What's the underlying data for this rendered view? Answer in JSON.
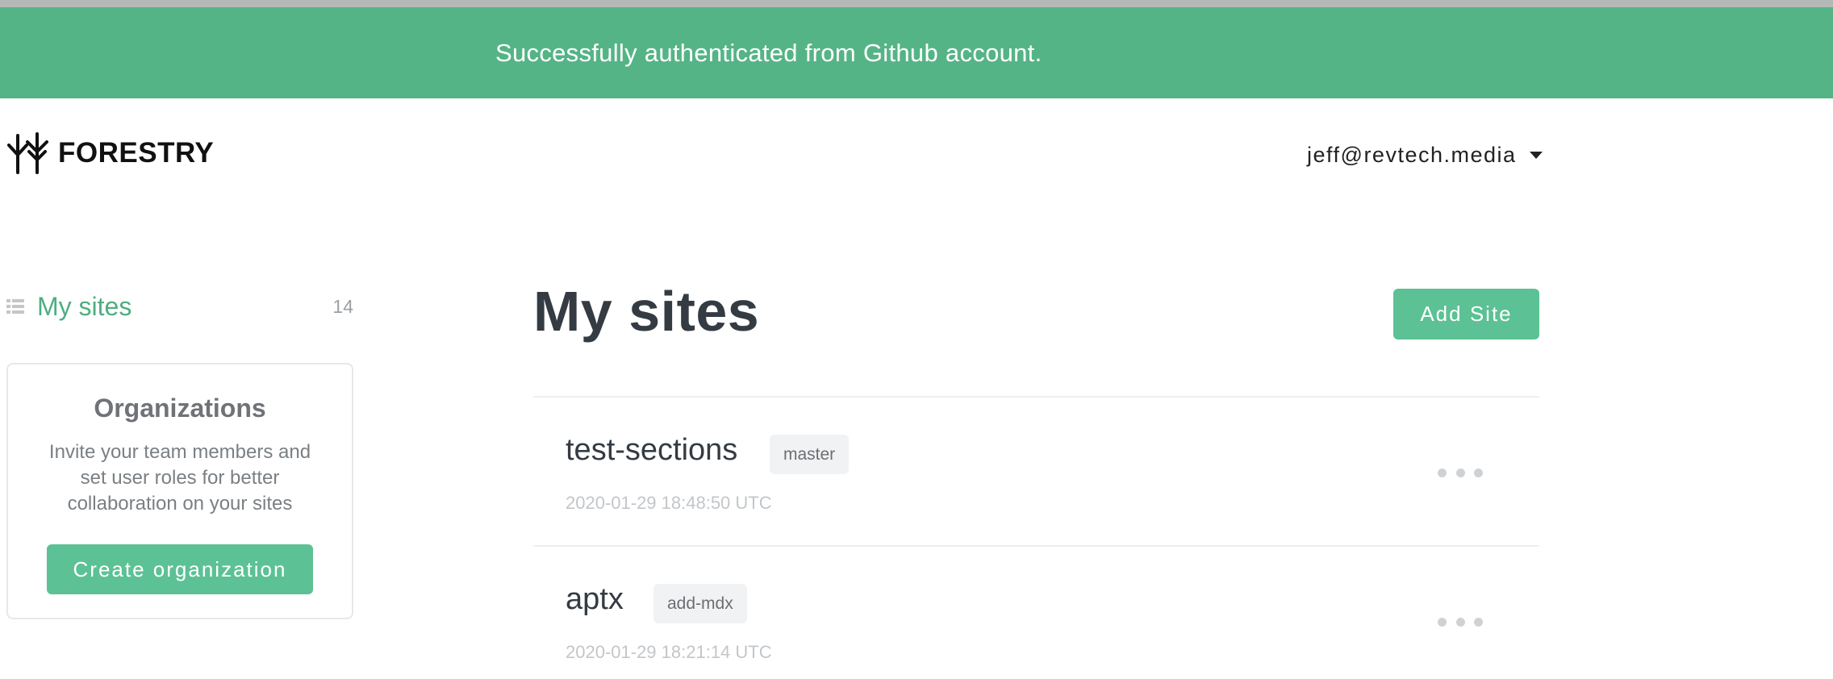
{
  "banner": {
    "message": "Successfully authenticated from Github account."
  },
  "header": {
    "logo_text": "FORESTRY",
    "logo_icon": "forestry-tree-icon",
    "user_email": "jeff@revtech.media",
    "user_menu_icon": "caret-down-icon"
  },
  "sidebar": {
    "items": [
      {
        "label": "My sites",
        "count": "14",
        "icon": "list-icon"
      }
    ],
    "org_card": {
      "title": "Organizations",
      "description": "Invite your team members and set user roles for better collaboration on your sites",
      "button_label": "Create organization"
    }
  },
  "main": {
    "title": "My sites",
    "add_button_label": "Add Site",
    "sites": [
      {
        "name": "test-sections",
        "branch": "master",
        "updated": "2020-01-29 18:48:50 UTC"
      },
      {
        "name": "aptx",
        "branch": "add-mdx",
        "updated": "2020-01-29 18:21:14 UTC"
      }
    ]
  },
  "colors": {
    "banner": "#55b486",
    "accent": "#5cc194",
    "accent_text": "#4eae80"
  }
}
